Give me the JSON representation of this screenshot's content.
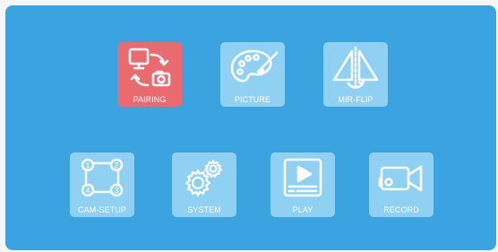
{
  "menu": {
    "selected": "pairing",
    "items": [
      {
        "id": "pairing",
        "label": "PAIRING",
        "icon": "pairing-icon"
      },
      {
        "id": "picture",
        "label": "PICTURE",
        "icon": "palette-icon"
      },
      {
        "id": "mir-flip",
        "label": "MIR-FLIP",
        "icon": "mirror-flip-icon"
      },
      {
        "id": "cam-setup",
        "label": "CAM-SETUP",
        "icon": "camera-grid-icon"
      },
      {
        "id": "system",
        "label": "SYSTEM",
        "icon": "gears-icon"
      },
      {
        "id": "play",
        "label": "PLAY",
        "icon": "play-video-icon"
      },
      {
        "id": "record",
        "label": "RECORD",
        "icon": "video-camera-icon"
      }
    ]
  },
  "colors": {
    "screen_bg": "#3ba4e0",
    "tile_bg": "#8fd0f3",
    "tile_selected_bg": "#e96a6f",
    "icon_stroke": "#ffffff"
  }
}
